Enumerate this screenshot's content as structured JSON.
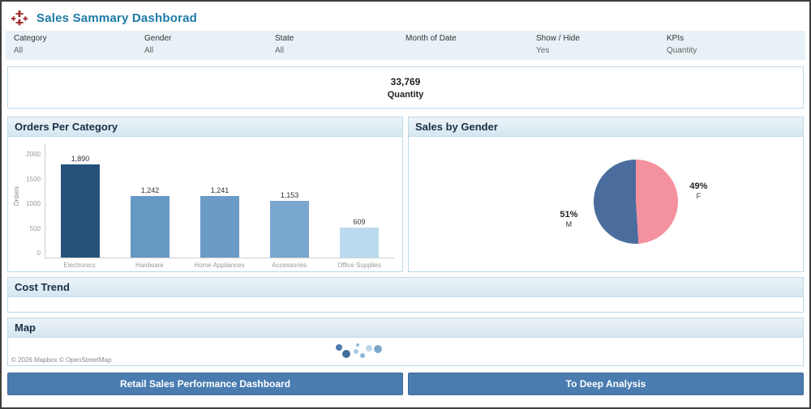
{
  "header": {
    "title": "Sales Sammary Dashborad"
  },
  "filter_bar": {
    "filters": [
      {
        "label": "Category",
        "value": "All"
      },
      {
        "label": "Gender",
        "value": "All"
      },
      {
        "label": "State",
        "value": "All"
      },
      {
        "label": "Month of Date",
        "value": ""
      },
      {
        "label": "Show / Hide",
        "value": "Yes"
      },
      {
        "label": "KPIs",
        "value": "Quantity"
      }
    ]
  },
  "kpi_card": {
    "value": "33,769",
    "label": "Quantity"
  },
  "panels": {
    "orders": {
      "title": "Orders Per Category"
    },
    "gender": {
      "title": "Sales by Gender"
    },
    "cost_trend": {
      "title": "Cost Trend"
    },
    "map": {
      "title": "Map",
      "attribution": "© 2026 Mapbox © OpenStreetMap"
    }
  },
  "chart_data": [
    {
      "type": "bar",
      "title": "Orders Per Category",
      "categories": [
        "Electronics",
        "Hardware",
        "Home Appliances",
        "Accessories",
        "Office Supplies"
      ],
      "values": [
        1890,
        1242,
        1241,
        1153,
        609
      ],
      "value_labels": [
        "1,890",
        "1,242",
        "1,241",
        "1,153",
        "609"
      ],
      "bar_colors": [
        "#27517b",
        "#6698c4",
        "#6b9cc6",
        "#79a6cd",
        "#badbed"
      ],
      "xlabel": "",
      "ylabel": "Orders",
      "ylim": [
        0,
        2000
      ],
      "yticks": [
        0,
        500,
        1000,
        1500,
        2000
      ],
      "grid": false,
      "legend": "none"
    },
    {
      "type": "pie",
      "title": "Sales by Gender",
      "slices": [
        {
          "label": "F",
          "pct_label": "49%",
          "value": 49,
          "color": "#f4919f"
        },
        {
          "label": "M",
          "pct_label": "51%",
          "value": 51,
          "color": "#4a6d9e"
        }
      ]
    }
  ],
  "map_points": [
    {
      "x": 408,
      "y": 12,
      "r": 4,
      "color": "#3a6ea5"
    },
    {
      "x": 417,
      "y": 20,
      "r": 5,
      "color": "#2e5f8f"
    },
    {
      "x": 429,
      "y": 17,
      "r": 3,
      "color": "#9ec6e0"
    },
    {
      "x": 437,
      "y": 22,
      "r": 3,
      "color": "#7fb0d4"
    },
    {
      "x": 445,
      "y": 13,
      "r": 4,
      "color": "#b5d2e6"
    },
    {
      "x": 456,
      "y": 14,
      "r": 5,
      "color": "#6f9dc4"
    },
    {
      "x": 431,
      "y": 9,
      "r": 2,
      "color": "#8ab4d6"
    }
  ],
  "nav_buttons": [
    {
      "label": "Retail Sales Performance Dashboard"
    },
    {
      "label": "To Deep Analysis"
    }
  ],
  "colors": {
    "title_text": "#1b7aa6",
    "filter_bar_bg": "#e7f1f6",
    "panel_border": "#bcd9e8",
    "button_bg": "#4a7cb0",
    "logo_maroon": "#a12b2b"
  }
}
